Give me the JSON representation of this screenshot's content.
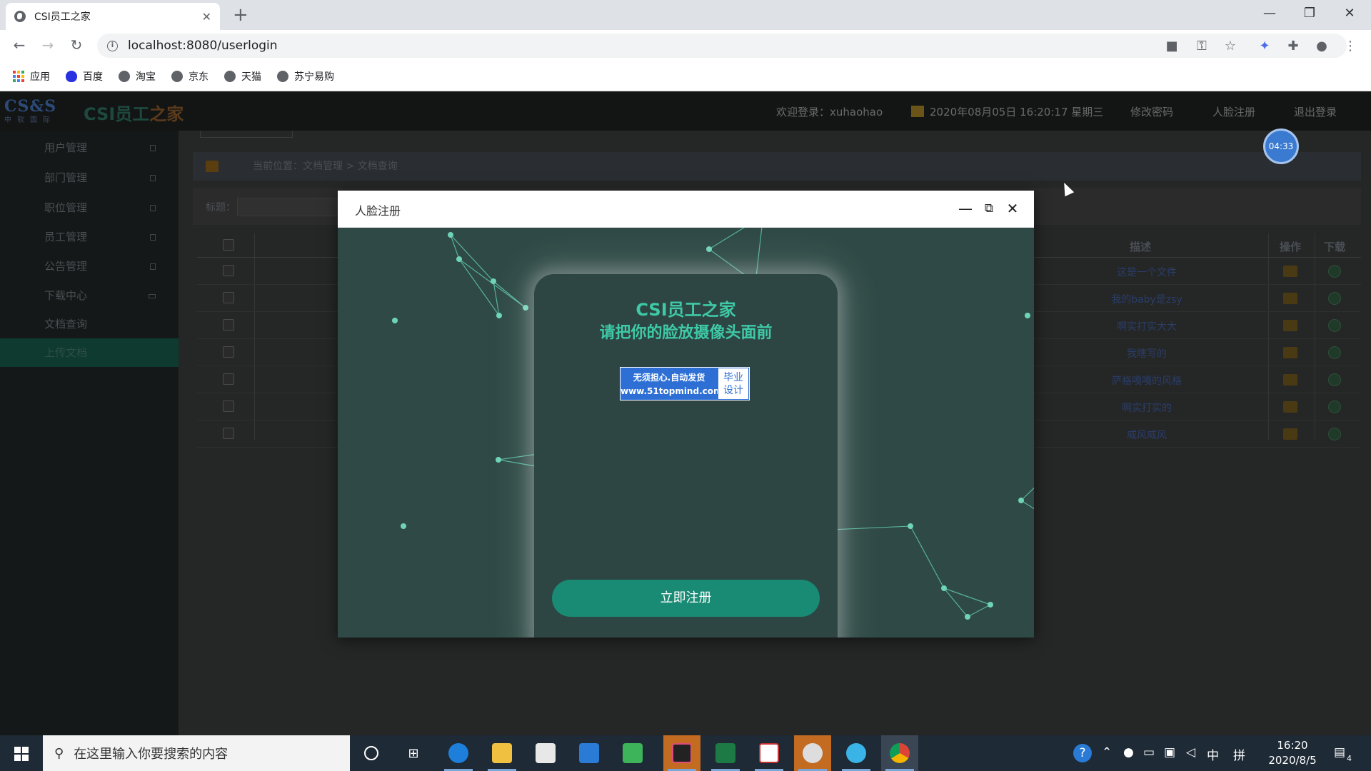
{
  "browser": {
    "tab_title": "CSI员工之家",
    "tab_close": "✕",
    "new_tab": "+",
    "url": "localhost:8080/userlogin",
    "window_controls": [
      "—",
      "❐",
      "✕"
    ],
    "bookmarks": [
      "应用",
      "百度",
      "淘宝",
      "京东",
      "天猫",
      "苏宁易购"
    ]
  },
  "app": {
    "logo_mark": "CS&S",
    "logo_sub": "中软国际",
    "brand_name": "CSI员工",
    "brand_name_accent": "之家",
    "welcome": "欢迎登录：xuhaohao",
    "datetime": "2020年08月05日 16:20:17 星期三",
    "links": [
      "修改密码",
      "人脸注册",
      "退出登录"
    ],
    "timer": "04:33"
  },
  "sidebar": {
    "items": [
      {
        "label": "用户管理"
      },
      {
        "label": "部门管理"
      },
      {
        "label": "职位管理"
      },
      {
        "label": "员工管理"
      },
      {
        "label": "公告管理"
      },
      {
        "label": "下载中心"
      },
      {
        "label": "文档查询"
      },
      {
        "label": "上传文档"
      }
    ]
  },
  "breadcrumb": {
    "text": "当前位置：文档管理 > 文档查询"
  },
  "search": {
    "label": "标题："
  },
  "table": {
    "headers": {
      "desc": "描述",
      "op": "操作",
      "download": "下载"
    },
    "rows": [
      {
        "desc": "这是一个文件"
      },
      {
        "desc": "我的baby是zsy"
      },
      {
        "desc": "啊实打实大大"
      },
      {
        "desc": "我瞎写的"
      },
      {
        "desc": "萨格嘎嘎的风格"
      },
      {
        "desc": "啊实打实的"
      },
      {
        "desc": "威风威风"
      }
    ]
  },
  "modal": {
    "title": "人脸注册",
    "brand": "CSI员工之家",
    "prompt": "请把你的脸放摄像头面前",
    "badge_left_1": "无须担心.自动发货",
    "badge_left_2": "www.51topmind.com",
    "badge_right_1": "毕业",
    "badge_right_2": "设计",
    "register_button": "立即注册",
    "colors": {
      "accent": "#3fc9a6",
      "button": "#198a74",
      "bg": "#2f4a46"
    }
  },
  "taskbar": {
    "search_placeholder": "在这里输入你要搜索的内容",
    "ime": "中",
    "layout": "拼",
    "time": "16:20",
    "date": "2020/8/5",
    "notifications": "4"
  }
}
